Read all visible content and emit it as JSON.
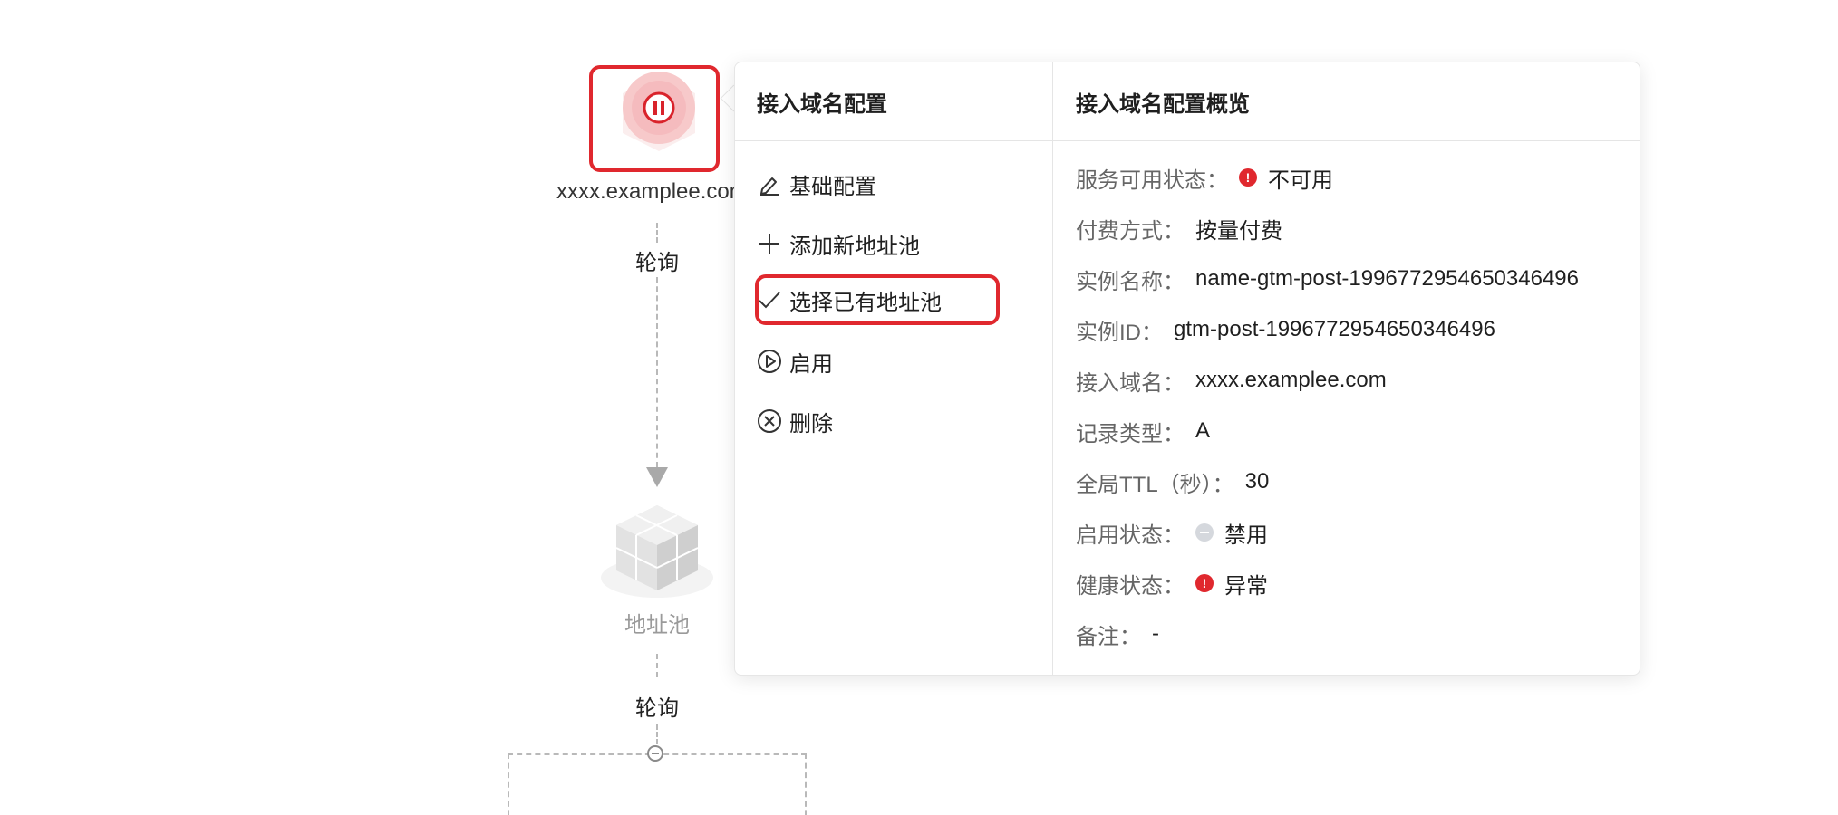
{
  "diagram": {
    "domain_node_label": "xxxx.examplee.com",
    "poll_label_1": "轮询",
    "poll_label_2": "轮询",
    "pool_label": "地址池"
  },
  "popup": {
    "menu_title": "接入域名配置",
    "overview_title": "接入域名配置概览",
    "menu": [
      {
        "label": "基础配置",
        "icon": "edit-icon"
      },
      {
        "label": "添加新地址池",
        "icon": "plus-icon"
      },
      {
        "label": "选择已有地址池",
        "icon": "check-icon"
      },
      {
        "label": "启用",
        "icon": "play-circle-icon"
      },
      {
        "label": "删除",
        "icon": "close-circle-icon"
      }
    ],
    "info": {
      "service_status": {
        "label": "服务可用状态：",
        "value": "不可用"
      },
      "billing": {
        "label": "付费方式：",
        "value": "按量付费"
      },
      "instance_name": {
        "label": "实例名称：",
        "value": "name-gtm-post-1996772954650346496"
      },
      "instance_id": {
        "label": "实例ID：",
        "value": "gtm-post-1996772954650346496"
      },
      "domain": {
        "label": "接入域名：",
        "value": "xxxx.examplee.com"
      },
      "record_type": {
        "label": "记录类型：",
        "value": "A"
      },
      "global_ttl": {
        "label": "全局TTL（秒）：",
        "value": "30"
      },
      "enable_status": {
        "label": "启用状态：",
        "value": "禁用"
      },
      "health_status": {
        "label": "健康状态：",
        "value": "异常"
      },
      "remark": {
        "label": "备注：",
        "value": "-"
      }
    }
  },
  "colors": {
    "highlight": "#e0282e",
    "error": "#e0282e",
    "disabled": "#d5d8dd"
  }
}
